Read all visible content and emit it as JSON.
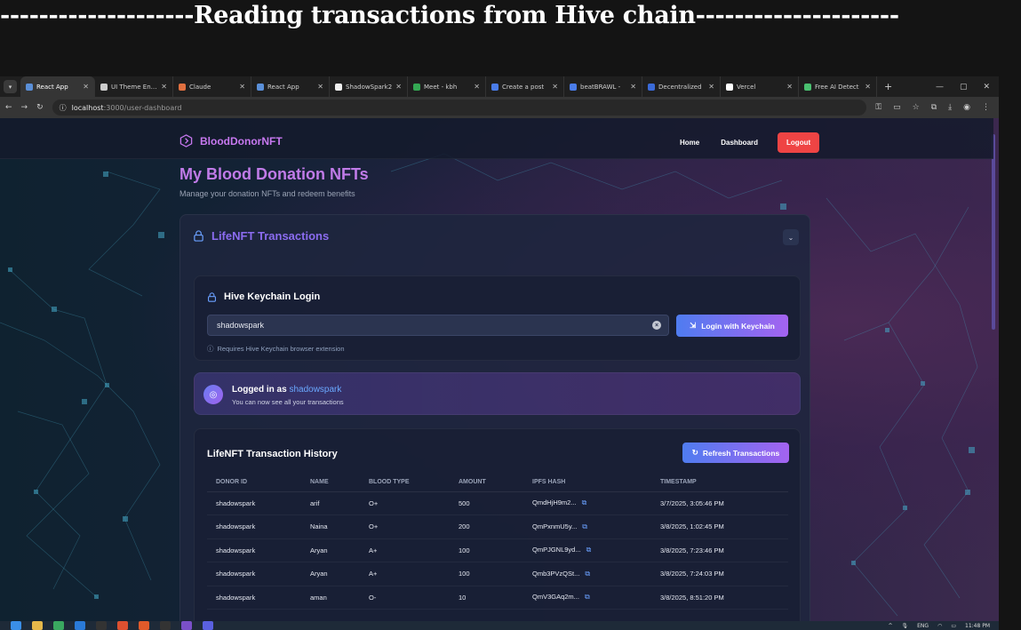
{
  "heading": "--------------------Reading transactions from Hive chain---------------------",
  "browser": {
    "tabs": [
      {
        "title": "React App",
        "fav": "#5a8fd8",
        "active": true,
        "w": 84
      },
      {
        "title": "UI Theme Enha",
        "fav": "#cccccc",
        "w": 88
      },
      {
        "title": "Claude",
        "fav": "#e07040",
        "w": 88
      },
      {
        "title": "React App",
        "fav": "#5a8fd8",
        "w": 88
      },
      {
        "title": "ShadowSpark2",
        "fav": "#eeeeee",
        "w": 88
      },
      {
        "title": "Meet - kbh",
        "fav": "#34a853",
        "w": 88
      },
      {
        "title": "Create a post",
        "fav": "#4a7ce8",
        "w": 88
      },
      {
        "title": "beatBRAWL -",
        "fav": "#4a7ce8",
        "w": 88
      },
      {
        "title": "Decentralized",
        "fav": "#3a6ad8",
        "w": 88
      },
      {
        "title": "Vercel",
        "fav": "#ffffff",
        "w": 88
      },
      {
        "title": "Free AI Detect",
        "fav": "#4ac070",
        "w": 88
      }
    ],
    "url_host": "localhost",
    "url_path": ":3000/user-dashboard"
  },
  "app": {
    "brand": "BloodDonorNFT",
    "nav": {
      "home": "Home",
      "dashboard": "Dashboard",
      "logout": "Logout"
    },
    "page_title": "My Blood Donation NFTs",
    "page_subtitle": "Manage your donation NFTs and redeem benefits",
    "panel_title": "LifeNFT Transactions",
    "keychain": {
      "title": "Hive Keychain Login",
      "username": "shadowspark",
      "button": "Login with Keychain",
      "note": "Requires Hive Keychain browser extension"
    },
    "logged_in": {
      "prefix": "Logged in as ",
      "user": "shadowspark",
      "sub": "You can now see all your transactions"
    },
    "history": {
      "title": "LifeNFT Transaction History",
      "refresh": "Refresh Transactions",
      "columns": [
        "DONOR ID",
        "NAME",
        "BLOOD TYPE",
        "AMOUNT",
        "IPFS HASH",
        "TIMESTAMP"
      ],
      "rows": [
        [
          "shadowspark",
          "arif",
          "O+",
          "500",
          "QmdHjH9m2...",
          "3/7/2025, 3:05:46 PM"
        ],
        [
          "shadowspark",
          "Naina",
          "O+",
          "200",
          "QmPxnmU5y...",
          "3/8/2025, 1:02:45 PM"
        ],
        [
          "shadowspark",
          "Aryan",
          "A+",
          "100",
          "QmPJGNL9yd...",
          "3/8/2025, 7:23:46 PM"
        ],
        [
          "shadowspark",
          "Aryan",
          "A+",
          "100",
          "Qmb3PVzQSt...",
          "3/8/2025, 7:24:03 PM"
        ],
        [
          "shadowspark",
          "aman",
          "O-",
          "10",
          "QmV3GAq2m...",
          "3/8/2025, 8:51:20 PM"
        ]
      ]
    }
  },
  "taskbar": {
    "lang": "ENG",
    "time": "11:48 PM"
  }
}
